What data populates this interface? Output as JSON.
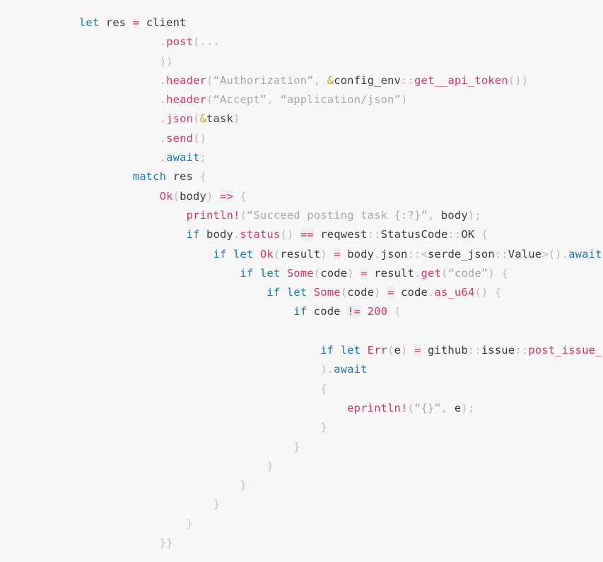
{
  "editor": {
    "language": "rust",
    "background_color": "#f7f7f7",
    "bottom_bar_color": "#1b1b1f",
    "colors": {
      "keyword": "#1a7bb9",
      "type_macro": "#d5376b",
      "identifier": "#3b3b3b",
      "punctuation": "#b9b9b9",
      "string": "#a8a8a8",
      "number": "#d5376b",
      "operator_highlight_bg": "#ededf2",
      "reference_sigil": "#c9a227"
    }
  },
  "code": {
    "lines": [
      "        let res = client",
      "                    .post(...",
      "                    ))",
      "                    .header(“Authorization”, &config_env::get__api_token())",
      "                    .header(“Accept”, “application/json”)",
      "                    .json(&task)",
      "                    .send()",
      "                    .await;",
      "                match res {",
      "                    Ok(body) => {",
      "                        println!(“Succeed posting task {:?}”, body);",
      "                        if body.status() == reqwest::StatusCode::OK {",
      "                            if let Ok(result) = body.json::<serde_json::Value>().await {",
      "                                if let Some(code) = result.get(“code”) {",
      "                                    if let Some(code) = code.as_u64() {",
      "                                        if code != 200 {",
      "",
      "                                            if let Err(e) = github::issue::post_issue_comm",
      "                                            ).await",
      "                                            {",
      "                                                eprintln!(“{}”, e);",
      "                                            }",
      "                                        }",
      "                                    }",
      "                                }",
      "                            }",
      "                        }",
      "                    }}"
    ],
    "line_count": 28,
    "truncated_line_index": 17,
    "truncated_line_note": "post_issue_comm",
    "tokens": [
      {
        "line": 0,
        "parts": [
          {
            "t": "        ",
            "c": "plain"
          },
          {
            "t": "let",
            "c": "kw"
          },
          {
            "t": " ",
            "c": "plain"
          },
          {
            "t": "res",
            "c": "ident"
          },
          {
            "t": " ",
            "c": "plain"
          },
          {
            "t": "=",
            "c": "op"
          },
          {
            "t": " ",
            "c": "plain"
          },
          {
            "t": "client",
            "c": "ident"
          }
        ]
      },
      {
        "line": 1,
        "parts": [
          {
            "t": "                    ",
            "c": "plain"
          },
          {
            "t": ".",
            "c": "punc"
          },
          {
            "t": "post",
            "c": "type"
          },
          {
            "t": "(...",
            "c": "punc"
          }
        ]
      },
      {
        "line": 2,
        "parts": [
          {
            "t": "                    ",
            "c": "plain"
          },
          {
            "t": "))",
            "c": "punc"
          }
        ]
      },
      {
        "line": 3,
        "parts": [
          {
            "t": "                    ",
            "c": "plain"
          },
          {
            "t": ".",
            "c": "punc"
          },
          {
            "t": "header",
            "c": "type"
          },
          {
            "t": "(",
            "c": "punc"
          },
          {
            "t": "“Authorization”",
            "c": "str"
          },
          {
            "t": ", ",
            "c": "punc"
          },
          {
            "t": "&",
            "c": "amp"
          },
          {
            "t": "config_env",
            "c": "ident"
          },
          {
            "t": "::",
            "c": "punc"
          },
          {
            "t": "get__api_token",
            "c": "type"
          },
          {
            "t": "())",
            "c": "punc"
          }
        ]
      },
      {
        "line": 4,
        "parts": [
          {
            "t": "                    ",
            "c": "plain"
          },
          {
            "t": ".",
            "c": "punc"
          },
          {
            "t": "header",
            "c": "type"
          },
          {
            "t": "(",
            "c": "punc"
          },
          {
            "t": "“Accept”",
            "c": "str"
          },
          {
            "t": ", ",
            "c": "punc"
          },
          {
            "t": "“application/json”",
            "c": "str"
          },
          {
            "t": ")",
            "c": "punc"
          }
        ]
      },
      {
        "line": 5,
        "parts": [
          {
            "t": "                    ",
            "c": "plain"
          },
          {
            "t": ".",
            "c": "punc"
          },
          {
            "t": "json",
            "c": "type"
          },
          {
            "t": "(",
            "c": "punc"
          },
          {
            "t": "&",
            "c": "amp"
          },
          {
            "t": "task",
            "c": "ident"
          },
          {
            "t": ")",
            "c": "punc"
          }
        ]
      },
      {
        "line": 6,
        "parts": [
          {
            "t": "                    ",
            "c": "plain"
          },
          {
            "t": ".",
            "c": "punc"
          },
          {
            "t": "send",
            "c": "type"
          },
          {
            "t": "()",
            "c": "punc"
          }
        ]
      },
      {
        "line": 7,
        "parts": [
          {
            "t": "                    ",
            "c": "plain"
          },
          {
            "t": ".",
            "c": "punc"
          },
          {
            "t": "await",
            "c": "kw"
          },
          {
            "t": ";",
            "c": "punc"
          }
        ]
      },
      {
        "line": 8,
        "parts": [
          {
            "t": "                ",
            "c": "plain"
          },
          {
            "t": "match",
            "c": "kw"
          },
          {
            "t": " ",
            "c": "plain"
          },
          {
            "t": "res",
            "c": "ident"
          },
          {
            "t": " ",
            "c": "plain"
          },
          {
            "t": "{",
            "c": "brace"
          }
        ]
      },
      {
        "line": 9,
        "parts": [
          {
            "t": "                    ",
            "c": "plain"
          },
          {
            "t": "Ok",
            "c": "type"
          },
          {
            "t": "(",
            "c": "punc"
          },
          {
            "t": "body",
            "c": "ident"
          },
          {
            "t": ")",
            "c": "punc"
          },
          {
            "t": " ",
            "c": "plain"
          },
          {
            "t": "=>",
            "c": "op"
          },
          {
            "t": " ",
            "c": "plain"
          },
          {
            "t": "{",
            "c": "brace"
          }
        ]
      },
      {
        "line": 10,
        "parts": [
          {
            "t": "                        ",
            "c": "plain"
          },
          {
            "t": "println!",
            "c": "type"
          },
          {
            "t": "(",
            "c": "punc"
          },
          {
            "t": "“Succeed posting task {:?}”",
            "c": "str"
          },
          {
            "t": ", ",
            "c": "punc"
          },
          {
            "t": "body",
            "c": "ident"
          },
          {
            "t": ");",
            "c": "punc"
          }
        ]
      },
      {
        "line": 11,
        "parts": [
          {
            "t": "                        ",
            "c": "plain"
          },
          {
            "t": "if",
            "c": "kw"
          },
          {
            "t": " ",
            "c": "plain"
          },
          {
            "t": "body",
            "c": "ident"
          },
          {
            "t": ".",
            "c": "punc"
          },
          {
            "t": "status",
            "c": "type"
          },
          {
            "t": "()",
            "c": "punc"
          },
          {
            "t": " ",
            "c": "plain"
          },
          {
            "t": "==",
            "c": "op"
          },
          {
            "t": " ",
            "c": "plain"
          },
          {
            "t": "reqwest",
            "c": "ident"
          },
          {
            "t": "::",
            "c": "punc"
          },
          {
            "t": "StatusCode",
            "c": "ident"
          },
          {
            "t": "::",
            "c": "punc"
          },
          {
            "t": "OK",
            "c": "ident"
          },
          {
            "t": " ",
            "c": "plain"
          },
          {
            "t": "{",
            "c": "brace"
          }
        ]
      },
      {
        "line": 12,
        "parts": [
          {
            "t": "                            ",
            "c": "plain"
          },
          {
            "t": "if",
            "c": "kw"
          },
          {
            "t": " ",
            "c": "plain"
          },
          {
            "t": "let",
            "c": "kw"
          },
          {
            "t": " ",
            "c": "plain"
          },
          {
            "t": "Ok",
            "c": "type"
          },
          {
            "t": "(",
            "c": "punc"
          },
          {
            "t": "result",
            "c": "ident"
          },
          {
            "t": ")",
            "c": "punc"
          },
          {
            "t": " ",
            "c": "plain"
          },
          {
            "t": "=",
            "c": "op"
          },
          {
            "t": " ",
            "c": "plain"
          },
          {
            "t": "body",
            "c": "ident"
          },
          {
            "t": ".",
            "c": "punc"
          },
          {
            "t": "json",
            "c": "ident"
          },
          {
            "t": "::<",
            "c": "punc"
          },
          {
            "t": "serde_json",
            "c": "ident"
          },
          {
            "t": "::",
            "c": "punc"
          },
          {
            "t": "Value",
            "c": "ident"
          },
          {
            "t": ">()",
            "c": "punc"
          },
          {
            "t": ".",
            "c": "punc"
          },
          {
            "t": "await",
            "c": "kw"
          },
          {
            "t": " ",
            "c": "plain"
          },
          {
            "t": "{",
            "c": "brace"
          }
        ]
      },
      {
        "line": 13,
        "parts": [
          {
            "t": "                                ",
            "c": "plain"
          },
          {
            "t": "if",
            "c": "kw"
          },
          {
            "t": " ",
            "c": "plain"
          },
          {
            "t": "let",
            "c": "kw"
          },
          {
            "t": " ",
            "c": "plain"
          },
          {
            "t": "Some",
            "c": "type"
          },
          {
            "t": "(",
            "c": "punc"
          },
          {
            "t": "code",
            "c": "ident"
          },
          {
            "t": ")",
            "c": "punc"
          },
          {
            "t": " ",
            "c": "plain"
          },
          {
            "t": "=",
            "c": "op"
          },
          {
            "t": " ",
            "c": "plain"
          },
          {
            "t": "result",
            "c": "ident"
          },
          {
            "t": ".",
            "c": "punc"
          },
          {
            "t": "get",
            "c": "type"
          },
          {
            "t": "(",
            "c": "punc"
          },
          {
            "t": "“code”",
            "c": "str"
          },
          {
            "t": ")",
            "c": "punc"
          },
          {
            "t": " ",
            "c": "plain"
          },
          {
            "t": "{",
            "c": "brace"
          }
        ]
      },
      {
        "line": 14,
        "parts": [
          {
            "t": "                                    ",
            "c": "plain"
          },
          {
            "t": "if",
            "c": "kw"
          },
          {
            "t": " ",
            "c": "plain"
          },
          {
            "t": "let",
            "c": "kw"
          },
          {
            "t": " ",
            "c": "plain"
          },
          {
            "t": "Some",
            "c": "type"
          },
          {
            "t": "(",
            "c": "punc"
          },
          {
            "t": "code",
            "c": "ident"
          },
          {
            "t": ")",
            "c": "punc"
          },
          {
            "t": " ",
            "c": "plain"
          },
          {
            "t": "=",
            "c": "op"
          },
          {
            "t": " ",
            "c": "plain"
          },
          {
            "t": "code",
            "c": "ident"
          },
          {
            "t": ".",
            "c": "punc"
          },
          {
            "t": "as_u64",
            "c": "type"
          },
          {
            "t": "()",
            "c": "punc"
          },
          {
            "t": " ",
            "c": "plain"
          },
          {
            "t": "{",
            "c": "brace"
          }
        ]
      },
      {
        "line": 15,
        "parts": [
          {
            "t": "                                        ",
            "c": "plain"
          },
          {
            "t": "if",
            "c": "kw"
          },
          {
            "t": " ",
            "c": "plain"
          },
          {
            "t": "code",
            "c": "ident"
          },
          {
            "t": " ",
            "c": "plain"
          },
          {
            "t": "!=",
            "c": "op"
          },
          {
            "t": " ",
            "c": "plain"
          },
          {
            "t": "200",
            "c": "num"
          },
          {
            "t": " ",
            "c": "plain"
          },
          {
            "t": "{",
            "c": "brace"
          }
        ]
      },
      {
        "line": 16,
        "parts": [
          {
            "t": "",
            "c": "plain"
          }
        ]
      },
      {
        "line": 17,
        "parts": [
          {
            "t": "                                            ",
            "c": "plain"
          },
          {
            "t": "if",
            "c": "kw"
          },
          {
            "t": " ",
            "c": "plain"
          },
          {
            "t": "let",
            "c": "kw"
          },
          {
            "t": " ",
            "c": "plain"
          },
          {
            "t": "Err",
            "c": "type"
          },
          {
            "t": "(",
            "c": "punc"
          },
          {
            "t": "e",
            "c": "ident"
          },
          {
            "t": ")",
            "c": "punc"
          },
          {
            "t": " ",
            "c": "plain"
          },
          {
            "t": "=",
            "c": "op"
          },
          {
            "t": " ",
            "c": "plain"
          },
          {
            "t": "github",
            "c": "ident"
          },
          {
            "t": "::",
            "c": "punc"
          },
          {
            "t": "issue",
            "c": "ident"
          },
          {
            "t": "::",
            "c": "punc"
          },
          {
            "t": "post_issue_comm",
            "c": "type"
          }
        ]
      },
      {
        "line": 18,
        "parts": [
          {
            "t": "                                            ",
            "c": "plain"
          },
          {
            "t": ")",
            "c": "punc"
          },
          {
            "t": ".",
            "c": "punc"
          },
          {
            "t": "await",
            "c": "kw"
          }
        ]
      },
      {
        "line": 19,
        "parts": [
          {
            "t": "                                            ",
            "c": "plain"
          },
          {
            "t": "{",
            "c": "brace"
          }
        ]
      },
      {
        "line": 20,
        "parts": [
          {
            "t": "                                                ",
            "c": "plain"
          },
          {
            "t": "eprintln!",
            "c": "type"
          },
          {
            "t": "(",
            "c": "punc"
          },
          {
            "t": "“{}”",
            "c": "str"
          },
          {
            "t": ", ",
            "c": "punc"
          },
          {
            "t": "e",
            "c": "ident"
          },
          {
            "t": ");",
            "c": "punc"
          }
        ]
      },
      {
        "line": 21,
        "parts": [
          {
            "t": "                                            ",
            "c": "plain"
          },
          {
            "t": "}",
            "c": "brace"
          }
        ]
      },
      {
        "line": 22,
        "parts": [
          {
            "t": "                                        ",
            "c": "plain"
          },
          {
            "t": "}",
            "c": "brace"
          }
        ]
      },
      {
        "line": 23,
        "parts": [
          {
            "t": "                                    ",
            "c": "plain"
          },
          {
            "t": "}",
            "c": "brace"
          }
        ]
      },
      {
        "line": 24,
        "parts": [
          {
            "t": "                                ",
            "c": "plain"
          },
          {
            "t": "}",
            "c": "brace"
          }
        ]
      },
      {
        "line": 25,
        "parts": [
          {
            "t": "                            ",
            "c": "plain"
          },
          {
            "t": "}",
            "c": "brace"
          }
        ]
      },
      {
        "line": 26,
        "parts": [
          {
            "t": "                        ",
            "c": "plain"
          },
          {
            "t": "}",
            "c": "brace"
          }
        ]
      },
      {
        "line": 27,
        "parts": [
          {
            "t": "                    ",
            "c": "plain"
          },
          {
            "t": "}}",
            "c": "brace"
          }
        ]
      }
    ]
  }
}
